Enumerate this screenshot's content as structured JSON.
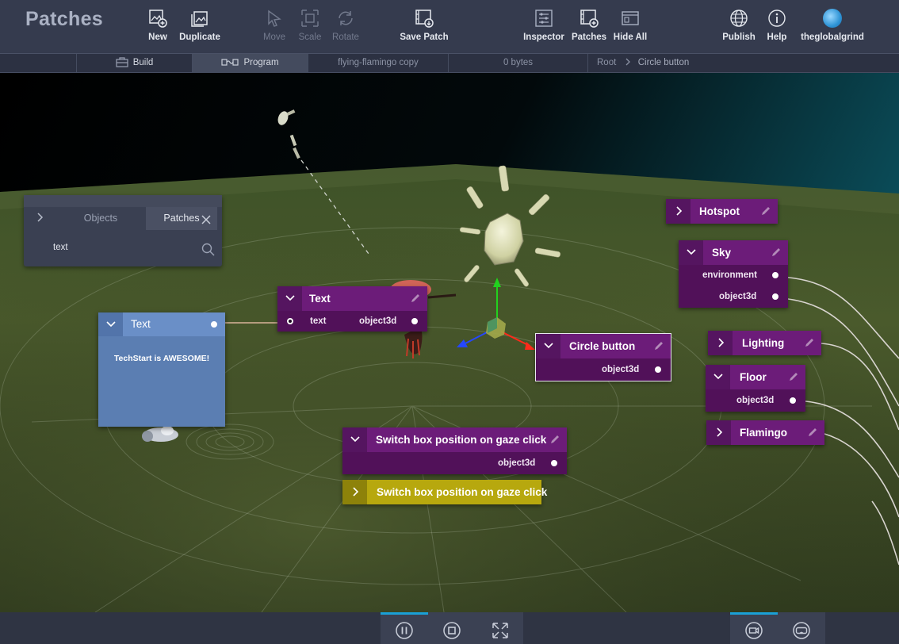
{
  "app": {
    "title": "Patches"
  },
  "toolbar": {
    "new": "New",
    "duplicate": "Duplicate",
    "move": "Move",
    "scale": "Scale",
    "rotate": "Rotate",
    "save_patch": "Save Patch",
    "inspector": "Inspector",
    "patches": "Patches",
    "hide_all": "Hide All",
    "publish": "Publish",
    "help": "Help",
    "user": "theglobalgrind"
  },
  "subbar": {
    "build": "Build",
    "program": "Program",
    "project_name": "flying-flamingo copy",
    "size": "0 bytes",
    "breadcrumb_root": "Root",
    "breadcrumb_current": "Circle button"
  },
  "side_panel": {
    "tab_objects": "Objects",
    "tab_patches": "Patches",
    "search_value": "text"
  },
  "nodes": {
    "text_blue": {
      "title": "Text",
      "content": "TechStart is AWESOME!"
    },
    "text": {
      "title": "Text",
      "port_in": "text",
      "port_out": "object3d"
    },
    "circle_button": {
      "title": "Circle button",
      "port_out": "object3d"
    },
    "switch_box": {
      "title": "Switch box position on gaze click",
      "port_out": "object3d"
    },
    "switch_box_collapsed": {
      "title": "Switch box position on gaze click"
    },
    "hotspot": {
      "title": "Hotspot"
    },
    "sky": {
      "title": "Sky",
      "port_1": "environment",
      "port_2": "object3d"
    },
    "lighting": {
      "title": "Lighting"
    },
    "floor": {
      "title": "Floor",
      "port_out": "object3d"
    },
    "flamingo": {
      "title": "Flamingo"
    }
  },
  "colors": {
    "toolbar_bg": "#353b4e",
    "patch_header": "#6c1c79",
    "patch_body": "#511159",
    "text_node": "#5b7eb2",
    "yellow_patch": "#b7a80e",
    "accent": "#1aa0d6"
  }
}
